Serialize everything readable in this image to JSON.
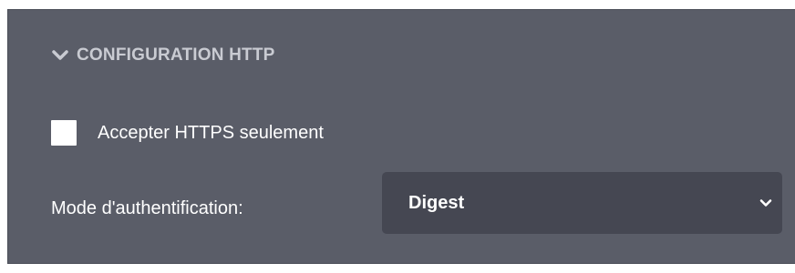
{
  "section": {
    "title": "CONFIGURATION HTTP",
    "icon": "chevron-down-icon"
  },
  "https_only": {
    "label": "Accepter HTTPS seulement",
    "checked": false
  },
  "auth_mode": {
    "label": "Mode d'authentification:",
    "selected": "Digest",
    "icon": "chevron-down-icon"
  },
  "colors": {
    "panel_bg": "#5a5d68",
    "select_bg": "#454752",
    "header_text": "#c9cbd2",
    "text": "#ffffff"
  }
}
